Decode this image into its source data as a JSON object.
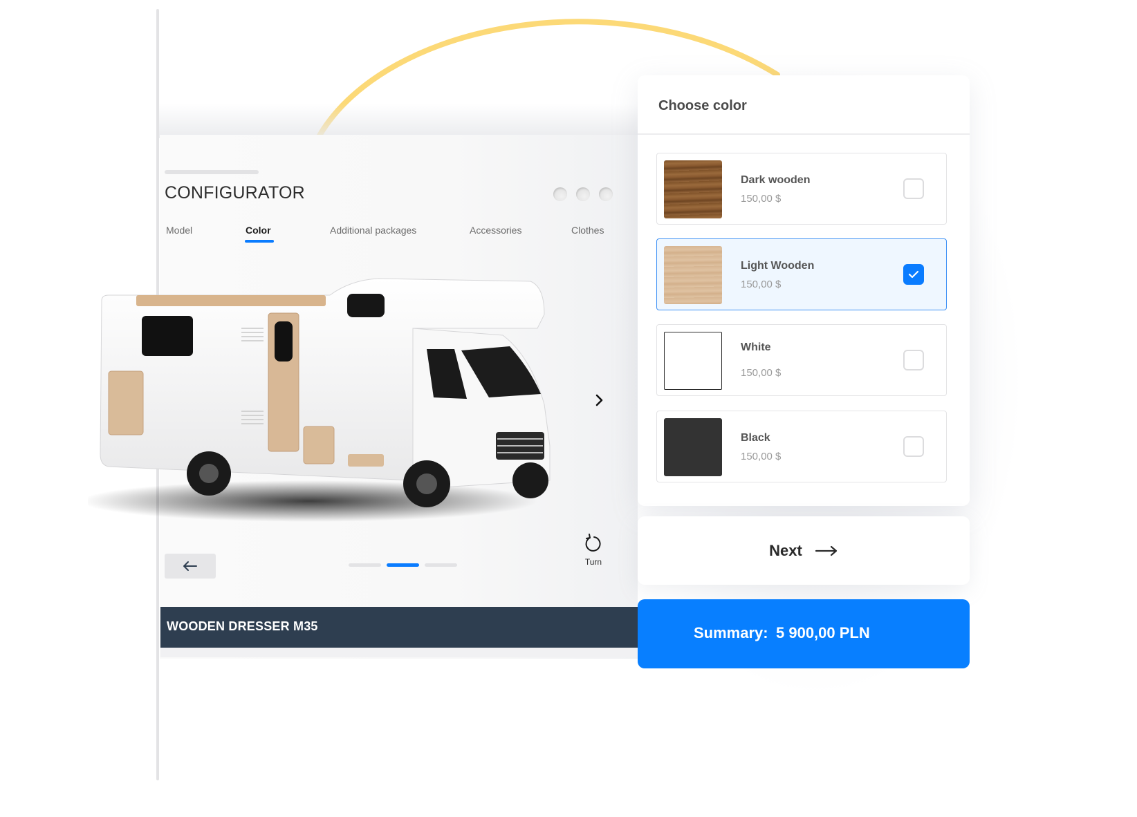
{
  "configurator": {
    "title": "CONFIGURATOR",
    "tabs": [
      {
        "label": "Model",
        "active": false
      },
      {
        "label": "Color",
        "active": true
      },
      {
        "label": "Additional packages",
        "active": false
      },
      {
        "label": "Accessories",
        "active": false
      },
      {
        "label": "Clothes",
        "active": false
      }
    ],
    "carousel": {
      "count": 3,
      "active_index": 1
    },
    "turn_label": "Turn",
    "product_name": "WOODEN DRESSER M35"
  },
  "color_panel": {
    "heading": "Choose color",
    "options": [
      {
        "name": "Dark wooden",
        "price": "150,00 $",
        "swatch": "#8a5a30",
        "selected": false
      },
      {
        "name": "Light Wooden",
        "price": "150,00 $",
        "swatch": "#d9b896",
        "selected": true
      },
      {
        "name": "White",
        "price": "150,00 $",
        "swatch": "#ffffff",
        "selected": false
      },
      {
        "name": "Black",
        "price": "150,00 $",
        "swatch": "#333333",
        "selected": false
      }
    ]
  },
  "next_button": {
    "label": "Next"
  },
  "summary": {
    "label": "Summary:",
    "value": "5 900,00 PLN"
  },
  "colors": {
    "accent": "#0a7cff",
    "summary_bg": "#087fff",
    "product_bar": "#2e3e50",
    "arc": "#fcd977"
  }
}
